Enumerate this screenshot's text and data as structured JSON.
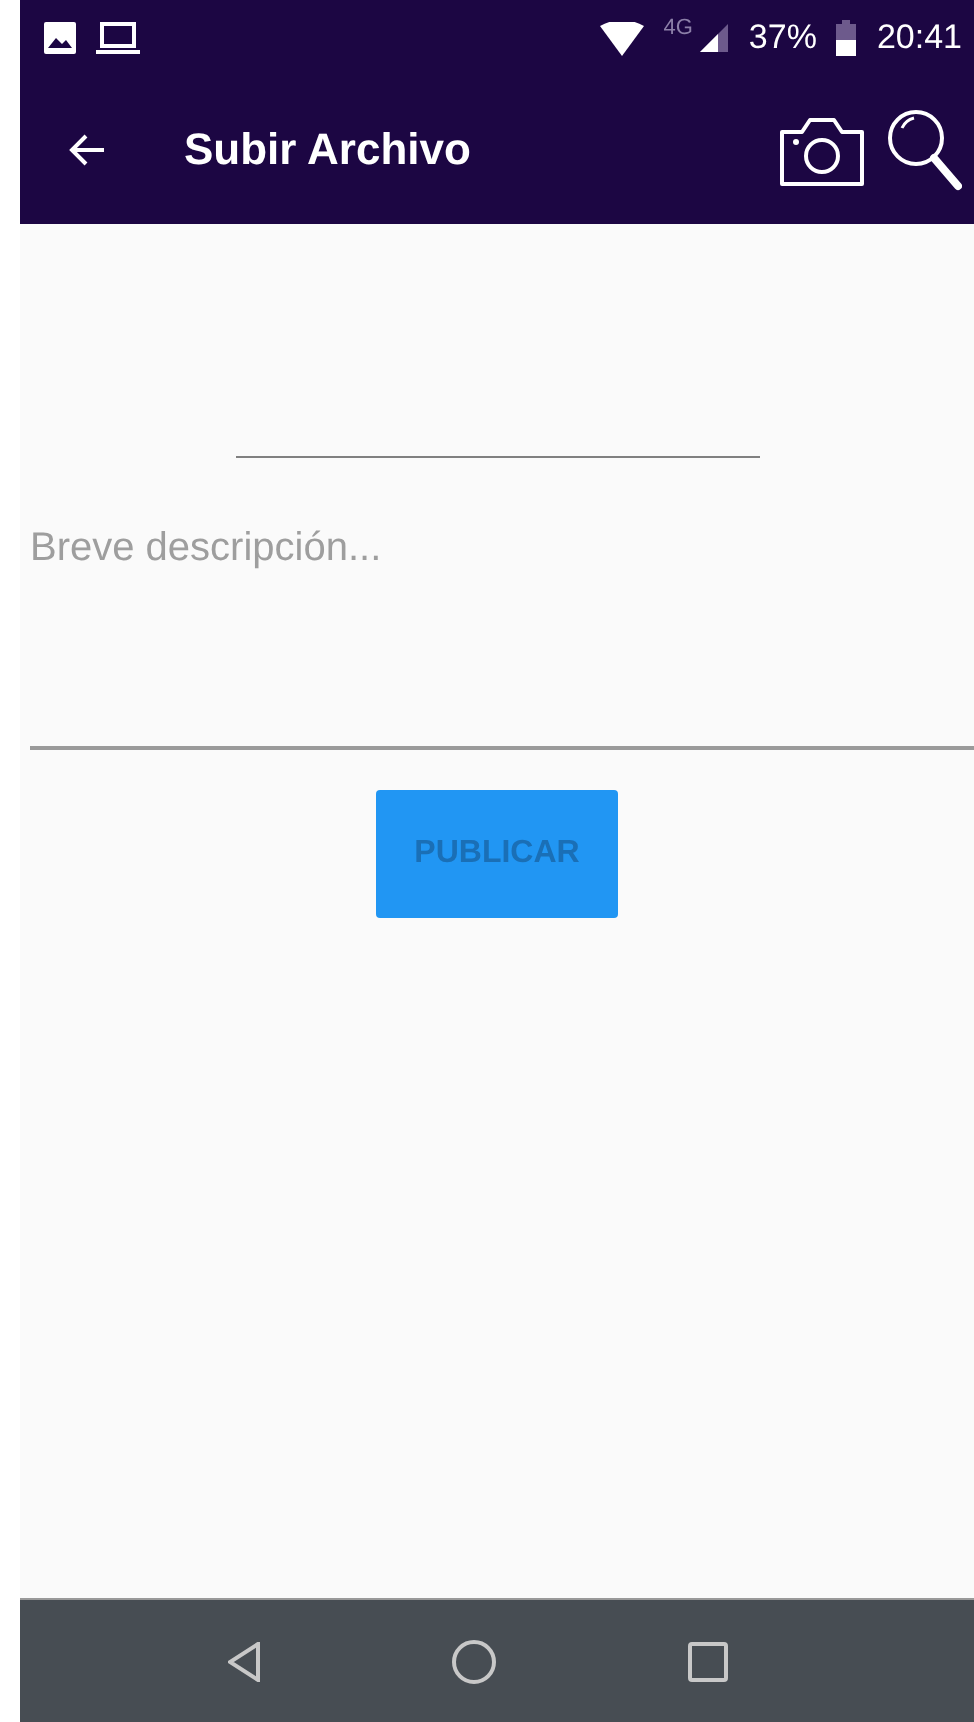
{
  "status_bar": {
    "network": "4G",
    "battery": "37%",
    "time": "20:41"
  },
  "app_bar": {
    "title": "Subir Archivo"
  },
  "form": {
    "description": {
      "placeholder": "Breve descripción..."
    },
    "submit": {
      "label": "PUBLICAR"
    }
  }
}
